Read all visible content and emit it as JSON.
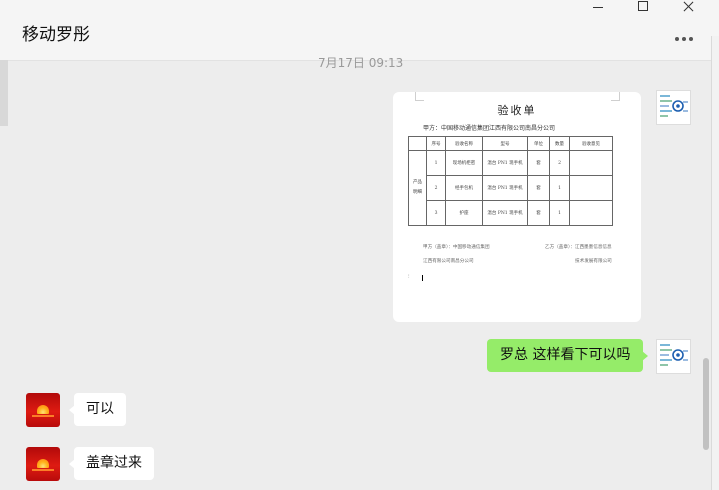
{
  "window": {
    "title": "移动罗彤",
    "controls": {
      "minimize": "minimize-icon",
      "maximize": "maximize-icon",
      "close": "close-icon"
    },
    "more": "more-icon"
  },
  "chat": {
    "timestamp": "7月17日 09:13",
    "document": {
      "title": "验收单",
      "party_a": "甲方：中国移动通信集团江西有限公司南昌分公司",
      "table": {
        "headers": [
          "序号",
          "验收名称",
          "型号",
          "单位",
          "数量",
          "验收意见"
        ],
        "row_group_label": "产品明细",
        "rows": [
          [
            "1",
            "现场机柜密",
            "温台 PN1 现手机",
            "套",
            "2",
            ""
          ],
          [
            "2",
            "经手包机",
            "温台 PN1 现手机",
            "套",
            "1",
            ""
          ],
          [
            "3",
            "护座",
            "温台 PN1 现手机",
            "套",
            "1",
            ""
          ]
        ]
      },
      "sign_left_1": "甲方（盖章）：中国移动通信集团",
      "sign_left_2": "江西有限公司南昌分公司",
      "sign_right_1": "乙方（盖章）：江西墨墨信息信息",
      "sign_right_2": "技术发展有限公司"
    },
    "messages": [
      {
        "from": "me",
        "text": "罗总 这样看下可以吗"
      },
      {
        "from": "peer",
        "text": "可以"
      },
      {
        "from": "peer",
        "text": "盖章过来"
      }
    ]
  }
}
